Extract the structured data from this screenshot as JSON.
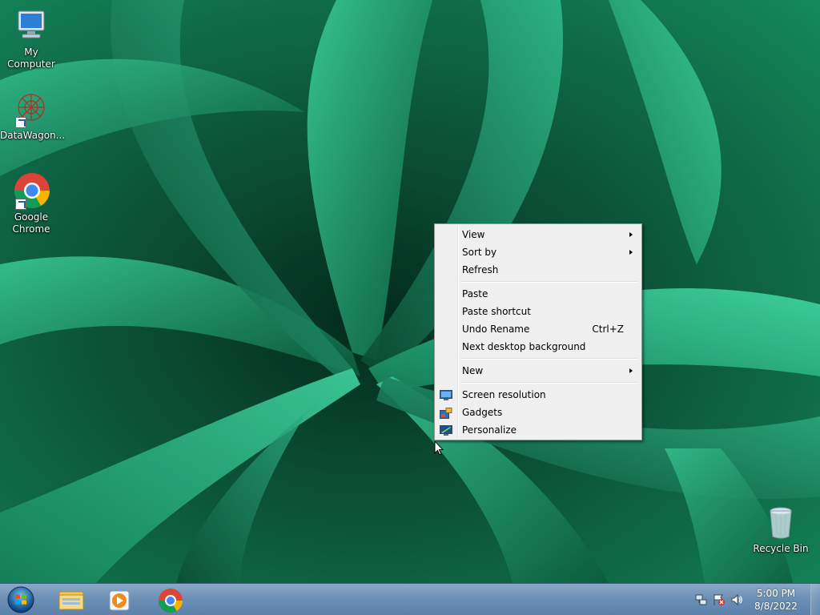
{
  "desktop": {
    "icons": [
      {
        "label": "My Computer",
        "icon": "my-computer-icon"
      },
      {
        "label": "DataWagon...",
        "icon": "datawagon-icon"
      },
      {
        "label": "Google Chrome",
        "icon": "chrome-icon"
      },
      {
        "label": "Recycle Bin",
        "icon": "recycle-bin-icon"
      }
    ],
    "wallpaper_colors": {
      "dark": "#032a1c",
      "mid": "#0f6b48",
      "light": "#2fb98a"
    }
  },
  "context_menu": {
    "items": {
      "view": "View",
      "sort_by": "Sort by",
      "refresh": "Refresh",
      "paste": "Paste",
      "paste_shortcut": "Paste shortcut",
      "undo_rename": "Undo Rename",
      "undo_rename_shortcut": "Ctrl+Z",
      "next_background": "Next desktop background",
      "new": "New",
      "screen_resolution": "Screen resolution",
      "gadgets": "Gadgets",
      "personalize": "Personalize"
    }
  },
  "taskbar": {
    "pinned": [
      "start-orb-icon",
      "explorer-icon",
      "media-player-icon",
      "chrome-icon"
    ],
    "tray_icons": [
      "network-icon",
      "action-center-icon",
      "volume-icon"
    ],
    "clock": {
      "time": "5:00 PM",
      "date": "8/8/2022"
    },
    "accent": "#6d90b5"
  }
}
